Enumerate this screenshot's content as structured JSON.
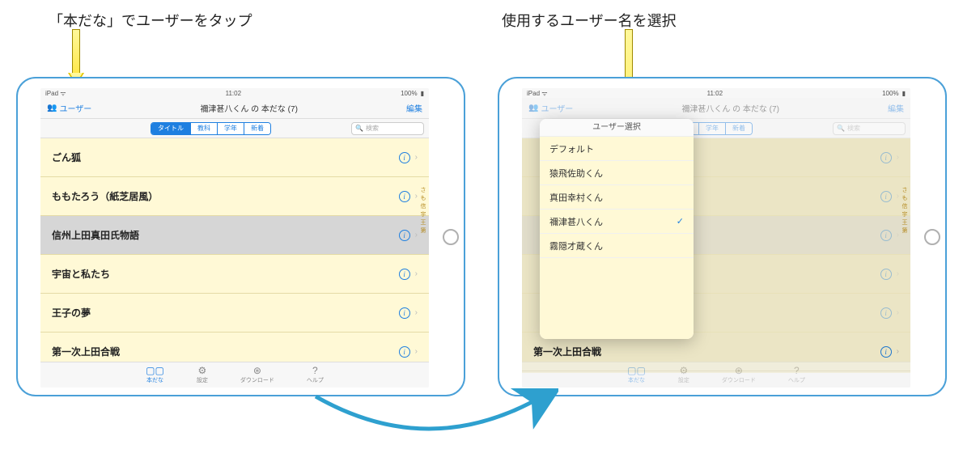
{
  "captions": {
    "left": "「本だな」でユーザーをタップ",
    "right": "使用するユーザー名を選択"
  },
  "status": {
    "device": "iPad",
    "wifi": "wifi",
    "time": "11:02",
    "battery": "100%"
  },
  "nav": {
    "user_label": "ユーザー",
    "title": "禰津甚八くん の 本だな (7)",
    "edit": "編集"
  },
  "segments": {
    "items": [
      "タイトル",
      "教科",
      "学年",
      "新着"
    ],
    "active_index": 0
  },
  "search": {
    "icon": "search",
    "placeholder": "検索"
  },
  "books": [
    {
      "title": "ごん狐",
      "selected": false
    },
    {
      "title": "ももたろう（紙芝居風）",
      "selected": false
    },
    {
      "title": "信州上田真田氏物語",
      "selected": true
    },
    {
      "title": "宇宙と私たち",
      "selected": false
    },
    {
      "title": "王子の夢",
      "selected": false
    },
    {
      "title": "第一次上田合戦",
      "selected": false
    }
  ],
  "index_letters": [
    "さ",
    "も",
    "信",
    "宇",
    "王",
    "第"
  ],
  "tabs": [
    {
      "icon": "▢▢",
      "label": "本だな",
      "active": true
    },
    {
      "icon": "⚙",
      "label": "設定",
      "active": false
    },
    {
      "icon": "⊛",
      "label": "ダウンロード",
      "active": false
    },
    {
      "icon": "?",
      "label": "ヘルプ",
      "active": false
    }
  ],
  "popover": {
    "title": "ユーザー選択",
    "items": [
      {
        "name": "デフォルト",
        "checked": false
      },
      {
        "name": "猿飛佐助くん",
        "checked": false
      },
      {
        "name": "真田幸村くん",
        "checked": false
      },
      {
        "name": "禰津甚八くん",
        "checked": true
      },
      {
        "name": "霧隠才蔵くん",
        "checked": false
      }
    ]
  },
  "right_visible_book": "第一次上田合戦",
  "colors": {
    "accent": "#1e7fe0",
    "list_bg": "#fff9d6",
    "arrow_blue": "#2ea0cf"
  }
}
